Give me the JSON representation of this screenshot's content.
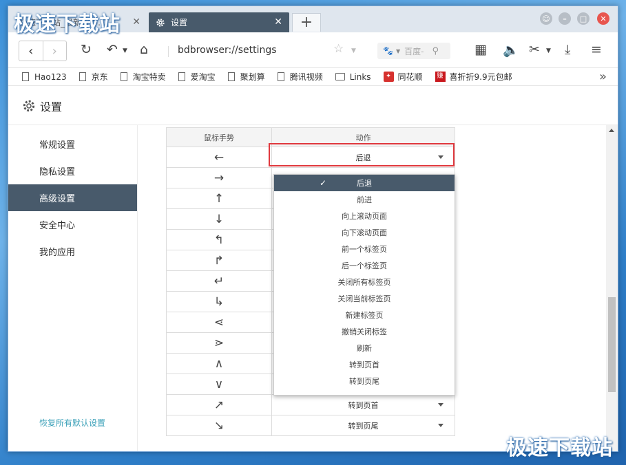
{
  "tabs": [
    {
      "label": "极速下载站_最新软件…",
      "active": false
    },
    {
      "label": "设置",
      "active": true
    }
  ],
  "new_tab_label": "+",
  "toolbar": {
    "url": "bdbrowser://settings",
    "search_placeholder": "百度-"
  },
  "bookmarks": [
    {
      "label": "Hao123",
      "icon": "doc"
    },
    {
      "label": "京东",
      "icon": "doc"
    },
    {
      "label": "淘宝特卖",
      "icon": "doc"
    },
    {
      "label": "爱淘宝",
      "icon": "doc"
    },
    {
      "label": "聚划算",
      "icon": "doc"
    },
    {
      "label": "腾讯视频",
      "icon": "doc"
    },
    {
      "label": "Links",
      "icon": "folder"
    },
    {
      "label": "同花顺",
      "icon": "tonghuashun"
    },
    {
      "label": "喜折折9.9元包邮",
      "icon": "zhuan"
    }
  ],
  "settings": {
    "title": "设置",
    "sidebar": [
      "常规设置",
      "隐私设置",
      "高级设置",
      "安全中心",
      "我的应用"
    ],
    "active_index": 2,
    "restore_label": "恢复所有默认设置"
  },
  "table": {
    "headers": [
      "鼠标手势",
      "动作"
    ],
    "rows": [
      {
        "gesture": "←",
        "action": "后退"
      },
      {
        "gesture": "→",
        "action": ""
      },
      {
        "gesture": "↑",
        "action": ""
      },
      {
        "gesture": "↓",
        "action": ""
      },
      {
        "gesture": "↰",
        "action": ""
      },
      {
        "gesture": "↱",
        "action": ""
      },
      {
        "gesture": "↵",
        "action": ""
      },
      {
        "gesture": "↳",
        "action": ""
      },
      {
        "gesture": "⋖",
        "action": ""
      },
      {
        "gesture": "⋗",
        "action": ""
      },
      {
        "gesture": "∧",
        "action": ""
      },
      {
        "gesture": "∨",
        "action": ""
      },
      {
        "gesture": "↗",
        "action": "转到页首"
      },
      {
        "gesture": "↘",
        "action": "转到页尾"
      }
    ]
  },
  "dropdown": {
    "selected": "后退",
    "check": "✓",
    "options": [
      "后退",
      "前进",
      "向上滚动页面",
      "向下滚动页面",
      "前一个标签页",
      "后一个标签页",
      "关闭所有标签页",
      "关闭当前标签页",
      "新建标签页",
      "撤销关闭标签",
      "刷新",
      "转到页首",
      "转到页尾"
    ]
  },
  "watermark": "极速下载站",
  "colors": {
    "accent": "#485a6b",
    "highlight_border": "#e0393e",
    "link": "#3aa0b8"
  }
}
